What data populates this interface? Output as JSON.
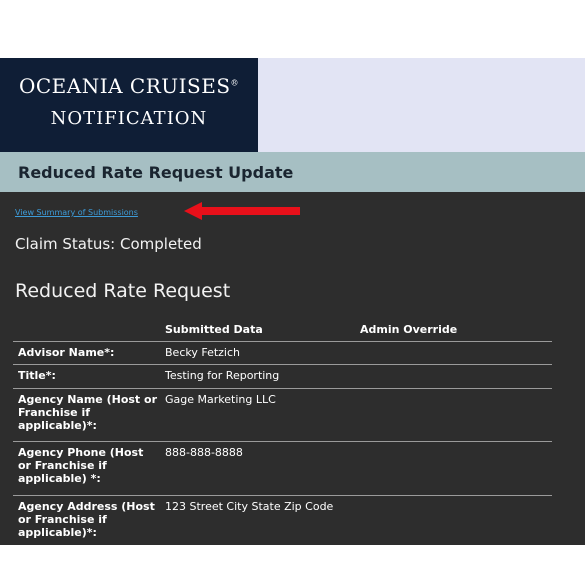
{
  "logo": {
    "brand": "OCEANIA CRUISES",
    "registered": "®",
    "subtitle": "NOTIFICATION"
  },
  "header": {
    "title": "Reduced Rate Request Update"
  },
  "summary_link": "View Summary of Submissions",
  "claim_status": "Claim Status: Completed",
  "section_title": "Reduced Rate Request",
  "table": {
    "columns": [
      "Submitted Data",
      "Admin Override"
    ],
    "rows": [
      {
        "label": "Advisor Name*:",
        "value": "Becky Fetzich"
      },
      {
        "label": "Title*:",
        "value": "Testing for Reporting"
      },
      {
        "label": "Agency Name (Host or Franchise if applicable)*:",
        "value": "Gage Marketing LLC"
      },
      {
        "label": "Agency Phone (Host or Franchise if applicable) *:",
        "value": "888-888-8888"
      },
      {
        "label": "Agency Address (Host or Franchise if applicable)*:",
        "value": "123 Street City State Zip Code"
      }
    ]
  },
  "colors": {
    "navy": "#0f1e36",
    "arrow": "#e8101a",
    "link": "#3d9bd8",
    "panel": "#2d2d2d",
    "subheader": "#a6bfc3"
  }
}
